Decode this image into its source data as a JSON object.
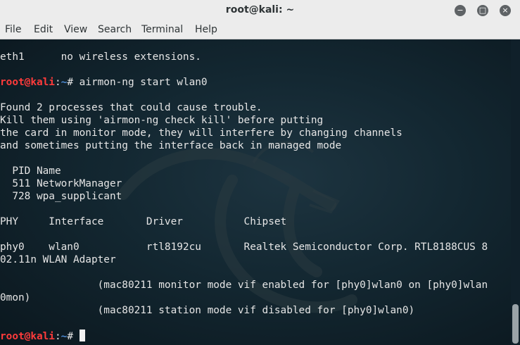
{
  "window": {
    "title": "root@kali: ~"
  },
  "controls": {
    "minimize_icon": "−",
    "maximize_icon": "□",
    "close_icon": "×"
  },
  "menu": [
    "File",
    "Edit",
    "View",
    "Search",
    "Terminal",
    "Help"
  ],
  "prompt": {
    "user": "root@kali",
    "sep": ":",
    "path": "~",
    "symbol": "# "
  },
  "terminal_lines": [
    "eth1      no wireless extensions.",
    "",
    {
      "prompt": true,
      "command": "airmon-ng start wlan0"
    },
    "",
    "Found 2 processes that could cause trouble.",
    "Kill them using 'airmon-ng check kill' before putting",
    "the card in monitor mode, they will interfere by changing channels",
    "and sometimes putting the interface back in managed mode",
    "",
    "  PID Name",
    "  511 NetworkManager",
    "  728 wpa_supplicant",
    "",
    "PHY     Interface       Driver          Chipset",
    "",
    "phy0    wlan0           rtl8192cu       Realtek Semiconductor Corp. RTL8188CUS 8",
    "02.11n WLAN Adapter",
    "",
    "                (mac80211 monitor mode vif enabled for [phy0]wlan0 on [phy0]wlan",
    "0mon)",
    "                (mac80211 station mode vif disabled for [phy0]wlan0)",
    "",
    {
      "prompt": true,
      "command": "",
      "cursor": true
    }
  ],
  "colors": {
    "prompt_user": "#ff3b3b",
    "prompt_path": "#4e8cd6",
    "text": "#e6e6e6"
  }
}
